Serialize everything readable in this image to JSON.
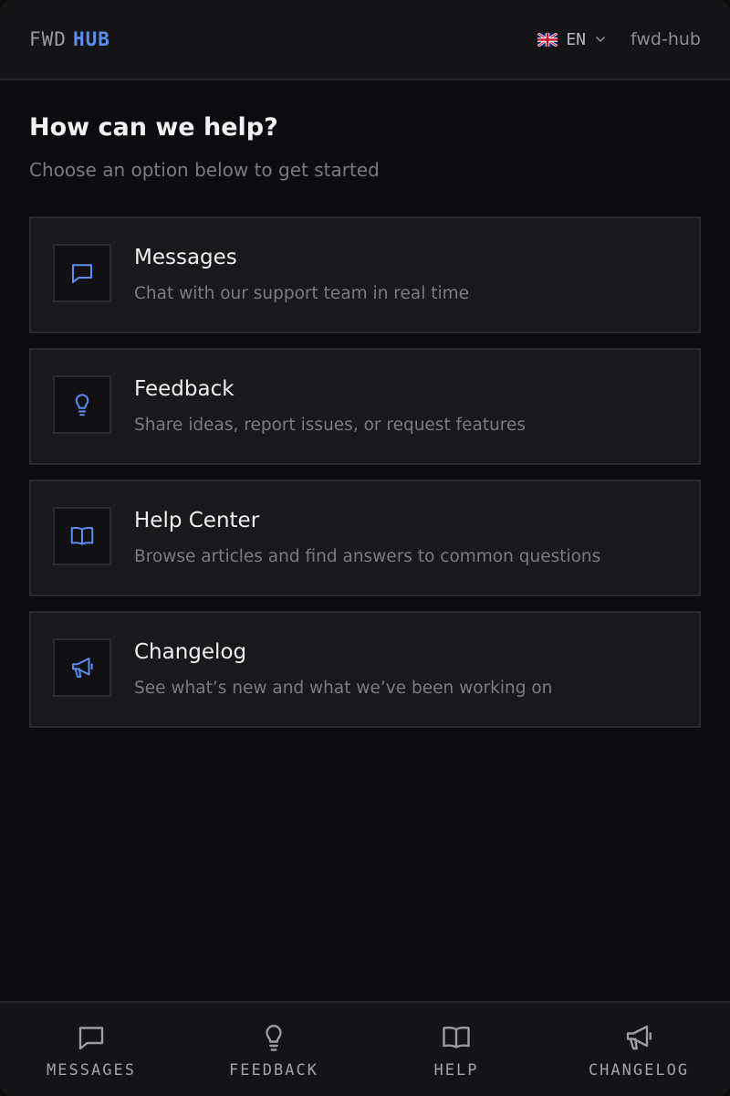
{
  "header": {
    "brand_left": "FWD",
    "brand_right": "HUB",
    "language": {
      "code": "EN",
      "flag_icon": "uk-flag-icon",
      "dropdown_icon": "chevron-down-icon"
    },
    "workspace": "fwd-hub"
  },
  "intro": {
    "title": "How can we help?",
    "subtitle": "Choose an option below to get started"
  },
  "cards": [
    {
      "title": "Messages",
      "description": "Chat with our support team in real time",
      "icon": "chat-bubble-icon"
    },
    {
      "title": "Feedback",
      "description": "Share ideas, report issues, or request features",
      "icon": "lightbulb-icon"
    },
    {
      "title": "Help Center",
      "description": "Browse articles and find answers to common questions",
      "icon": "book-open-icon"
    },
    {
      "title": "Changelog",
      "description": "See what’s new and what we’ve been working on",
      "icon": "megaphone-icon"
    }
  ],
  "bottom_nav": [
    {
      "label": "MESSAGES",
      "icon": "chat-bubble-icon"
    },
    {
      "label": "FEEDBACK",
      "icon": "lightbulb-icon"
    },
    {
      "label": "HELP",
      "icon": "book-open-icon"
    },
    {
      "label": "CHANGELOG",
      "icon": "megaphone-icon"
    }
  ],
  "colors": {
    "accent": "#5b8def",
    "background": "#0c0c0e",
    "card_background": "#19191b",
    "muted_text": "#7b7b81"
  }
}
